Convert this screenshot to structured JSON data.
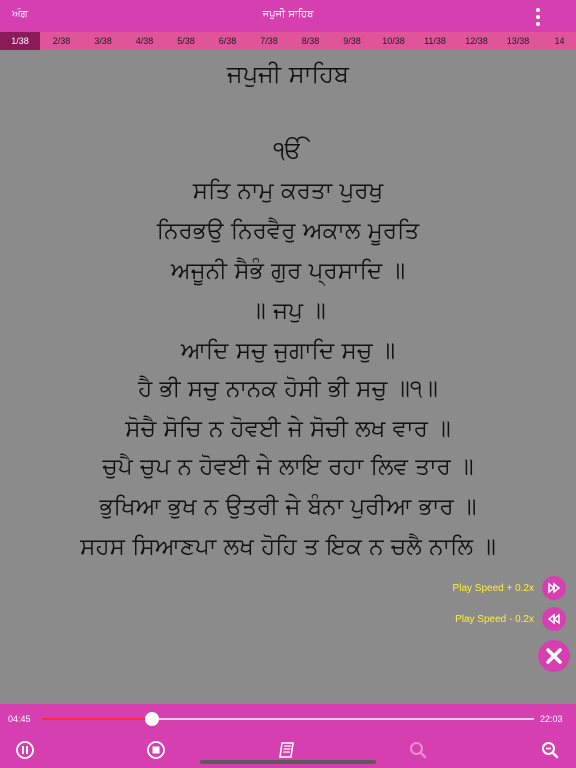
{
  "topbar": {
    "ang_label": "ਅੰਗ",
    "title": "ਜਪੁਜੀ ਸਾਹਿਬ",
    "menu_icon": "more-vertical-icon"
  },
  "tabs": [
    "1/38",
    "2/38",
    "3/38",
    "4/38",
    "5/38",
    "6/38",
    "7/38",
    "8/38",
    "9/38",
    "10/38",
    "11/38",
    "12/38",
    "13/38",
    "14"
  ],
  "active_tab": 0,
  "content": {
    "lines": [
      "ਜਪੁਜੀ ਸਾਹਿਬ",
      "ੴ",
      "ਸਤਿ ਨਾਮੁ ਕਰਤਾ ਪੁਰਖੁ",
      "ਨਿਰਭਉ ਨਿਰਵੈਰੁ ਅਕਾਲ ਮੂਰਤਿ",
      "ਅਜੂਨੀ ਸੈਭੰ ਗੁਰ ਪ੍ਰਸਾਦਿ ॥",
      "॥ ਜਪੁ ॥",
      "ਆਦਿ ਸਚੁ ਜੁਗਾਦਿ ਸਚੁ ॥",
      "ਹੈ ਭੀ ਸਚੁ ਨਾਨਕ ਹੋਸੀ ਭੀ ਸਚੁ ॥੧॥",
      "ਸੋਚੈ ਸੋਚਿ ਨ ਹੋਵਈ ਜੇ ਸੋਚੀ ਲਖ ਵਾਰ ॥",
      "ਚੁਪੈ ਚੁਪ ਨ ਹੋਵਈ ਜੇ ਲਾਇ ਰਹਾ ਲਿਵ ਤਾਰ ॥",
      "ਭੁਖਿਆ ਭੁਖ ਨ ਉਤਰੀ ਜੇ ਬੰਨਾ ਪੁਰੀਆ ਭਾਰ ॥",
      "ਸਹਸ ਸਿਆਣਪਾ ਲਖ ਹੋਹਿ ਤ ਇਕ ਨ ਚਲੈ ਨਾਲਿ ॥"
    ]
  },
  "speed": {
    "up_label": "Play Speed + 0.2x",
    "down_label": "Play Speed - 0.2x",
    "up_icon": "fast-forward-icon",
    "down_icon": "rewind-icon",
    "close_icon": "close-icon"
  },
  "player": {
    "elapsed": "04:45",
    "total": "22:03",
    "progress": 0.223,
    "icons": [
      "pause-icon",
      "stop-icon",
      "book-icon",
      "search-disabled-icon",
      "zoom-out-icon"
    ]
  },
  "colors": {
    "accent": "#d63fb0",
    "tabbar": "#e0559a",
    "active_tab": "#8a1a5a",
    "content_bg": "#8b8b8b",
    "speed_text": "#ffef3a",
    "progress": "#ff2a3a"
  }
}
